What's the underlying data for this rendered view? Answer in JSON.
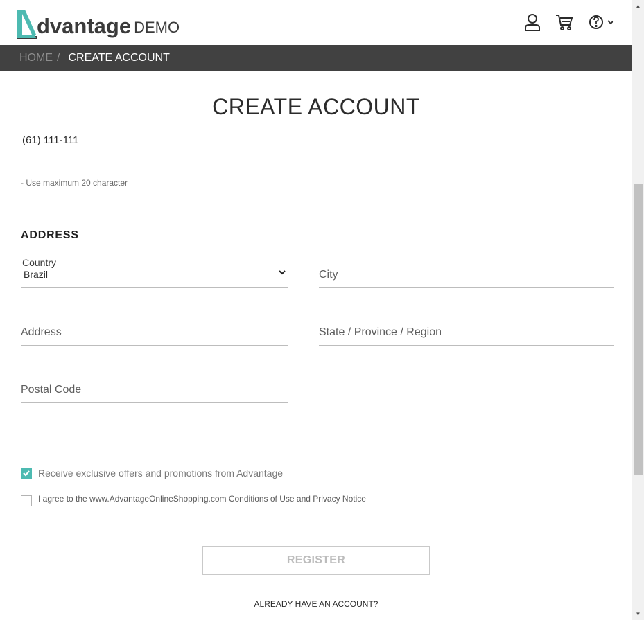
{
  "header": {
    "logo_word": "dvantage",
    "logo_suffix": "DEMO",
    "user_icon": "user-icon",
    "cart_icon": "cart-icon",
    "help_icon": "help-icon"
  },
  "breadcrumb": {
    "home": "HOME",
    "separator": "/",
    "current": "CREATE ACCOUNT"
  },
  "page_title": "CREATE ACCOUNT",
  "phone": {
    "value": "(61) 111-111",
    "hint": "- Use maximum 20 character"
  },
  "address_section": {
    "title": "ADDRESS",
    "country": {
      "label": "Country",
      "value": "Brazil"
    },
    "city_placeholder": "City",
    "address_placeholder": "Address",
    "state_placeholder": "State / Province / Region",
    "postal_placeholder": "Postal Code"
  },
  "offers_checkbox": {
    "label": "Receive exclusive offers and promotions from Advantage",
    "checked": true
  },
  "agree_checkbox": {
    "label": "I agree to the www.AdvantageOnlineShopping.com Conditions of Use and Privacy Notice",
    "checked": false
  },
  "register_button": "REGISTER",
  "already_link": "ALREADY HAVE AN ACCOUNT?",
  "colors": {
    "accent": "#4dbab1",
    "bar": "#414141"
  }
}
